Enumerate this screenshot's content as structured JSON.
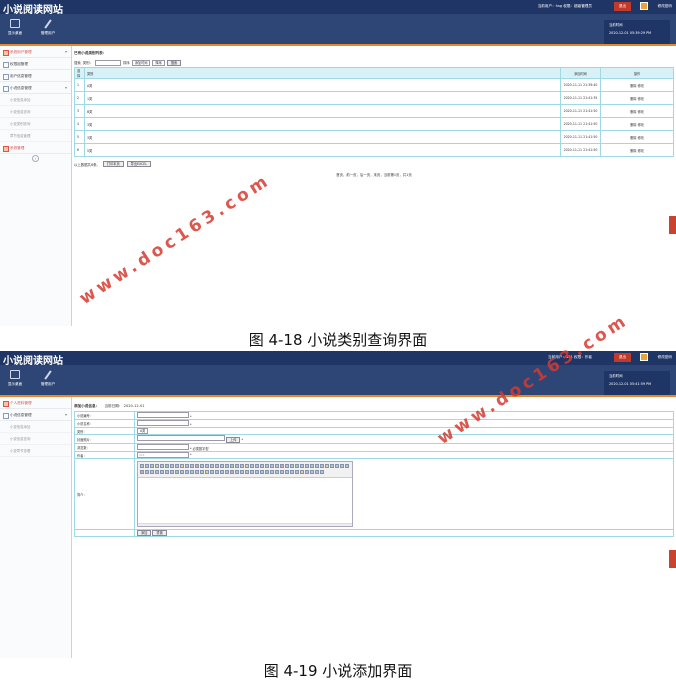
{
  "shot1": {
    "app_title": "小说阅读网站",
    "user_info": "当前用户：hsg 权限：超级管理员",
    "logout": "退出",
    "change_pwd": "修改密码",
    "nav": [
      "显示桌面",
      "管理用户"
    ],
    "time_label": "当前时间",
    "time_value": "2020-12-01 05:39:29 PM",
    "sidebar": [
      {
        "label": "系统用户管理",
        "active": true,
        "open": true
      },
      {
        "label": "权限组管理"
      },
      {
        "label": "用户信息管理"
      },
      {
        "label": "小说信息管理",
        "open": true
      }
    ],
    "sidebar_subs": [
      "小说信息添加",
      "小说信息查询",
      "小说类别查询",
      "章节信息管理"
    ],
    "sidebar_last": "系统管理",
    "section_title": "已有小说类别列表：",
    "search": {
      "label1": "搜索",
      "label2": "类别：",
      "label3": "排序",
      "sort_field": "添加时间",
      "order": "降序",
      "button": "搜索"
    },
    "table": {
      "headers": [
        "选择",
        "类别",
        "添加时间",
        "操作"
      ],
      "rows": [
        {
          "id": "1",
          "name": "A类",
          "time": "2020-11-11 21:39:40",
          "ops": "删除 修改"
        },
        {
          "id": "2",
          "name": "1类",
          "time": "2020-11-11 21:41:35",
          "ops": "删除 修改"
        },
        {
          "id": "3",
          "name": "B类",
          "time": "2020-11-11 21:41:50",
          "ops": "删除 修改"
        },
        {
          "id": "4",
          "name": "3类",
          "time": "2020-11-11 21:41:50",
          "ops": "删除 修改"
        },
        {
          "id": "5",
          "name": "3类",
          "time": "2020-11-11 21:41:50",
          "ops": "删除 修改"
        },
        {
          "id": "6",
          "name": "5类",
          "time": "2020-11-11 21:41:50",
          "ops": "删除 修改"
        }
      ]
    },
    "total_text": "以上数据共6条。",
    "print_btn": "打印本页",
    "export_btn": "导出EXCEL",
    "pager": "首页，前一页，后一页，末页，当前第1页，共1页"
  },
  "caption1": "图 4-18 小说类别查询界面",
  "shot2": {
    "app_title": "小说阅读网站",
    "user_info": "当前用户：111 权限：作者",
    "logout": "退出",
    "change_pwd": "修改密码",
    "nav": [
      "显示桌面",
      "管理用户"
    ],
    "time_label": "当前时间",
    "time_value": "2020-12-01 05:41:59 PM",
    "sidebar": [
      {
        "label": "个人资料管理",
        "active": true
      },
      {
        "label": "小说信息管理",
        "open": true
      }
    ],
    "sidebar_subs": [
      "小说信息添加",
      "小说信息查询",
      "小说章节查看"
    ],
    "section_title": "添加小说信息：",
    "date_label": "当前日期：",
    "date_value": "2020-12-01",
    "fields": [
      {
        "label": "小说编号：",
        "value": ""
      },
      {
        "label": "小说名称：",
        "value": ""
      },
      {
        "label": "类别：",
        "value": "A类"
      },
      {
        "label": "封面照片：",
        "value": ""
      },
      {
        "label": "浏览数：",
        "value": "",
        "hint": "必需数字型"
      },
      {
        "label": "作者：",
        "value": "111"
      }
    ],
    "upload_btn": "上传",
    "intro_label": "简介：",
    "submit_btn": "添加",
    "reset_btn": "重置"
  },
  "caption2": "图 4-19 小说添加界面",
  "watermark": "www.doc163.com"
}
